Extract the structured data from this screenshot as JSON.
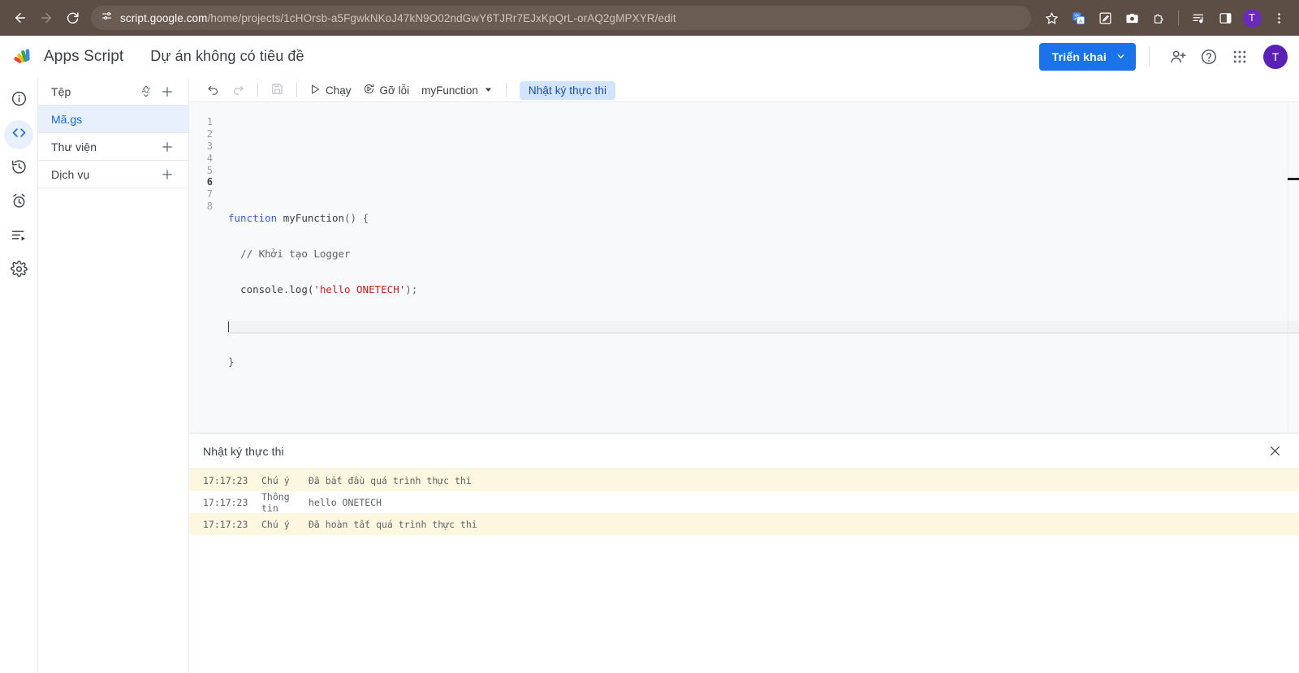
{
  "browser": {
    "back_icon": "arrow-left-icon",
    "forward_icon": "arrow-right-icon",
    "reload_icon": "reload-icon",
    "site_settings_icon": "tune-icon",
    "url_domain": "script.google.com",
    "url_path": "/home/projects/1cHOrsb-a5FgwkNKoJ47kN9O02ndGwY6TJRr7EJxKpQrL-orAQ2gMPXYR/edit",
    "toolbar_icons": [
      "bookmark-star-icon",
      "google-translate-icon",
      "note-edit-icon",
      "screenshot-camera-icon",
      "extensions-puzzle-icon",
      "reading-list-icon",
      "side-panel-icon"
    ],
    "profile_initial": "T",
    "menu_icon": "three-dot-menu-icon",
    "chrome_bg": "#5d4e45"
  },
  "header": {
    "logo_icon": "apps-script-logo",
    "brand": "Apps Script",
    "project_title": "Dự án không có tiêu đề",
    "deploy_label": "Triển khai",
    "deploy_caret_icon": "chevron-down-icon",
    "share_icon": "person-add-icon",
    "help_icon": "help-circle-icon",
    "apps_icon": "apps-grid-icon",
    "avatar_initial": "T",
    "accent": "#1a73e8"
  },
  "rail": {
    "items": [
      {
        "name": "overview",
        "icon": "info-circle-icon",
        "active": false
      },
      {
        "name": "editor",
        "icon": "code-brackets-icon",
        "active": true
      },
      {
        "name": "history",
        "icon": "clock-history-icon",
        "active": false
      },
      {
        "name": "triggers",
        "icon": "alarm-clock-icon",
        "active": false
      },
      {
        "name": "executions",
        "icon": "list-play-icon",
        "active": false
      },
      {
        "name": "settings",
        "icon": "gear-icon",
        "active": false
      }
    ]
  },
  "files": {
    "section_files": "Tệp",
    "sort_icon": "sort-az-icon",
    "add_icon": "plus-icon",
    "items": [
      {
        "name": "Mã.gs",
        "selected": true
      }
    ],
    "section_libraries": "Thư viện",
    "section_services": "Dịch vụ"
  },
  "toolbar": {
    "undo_icon": "undo-icon",
    "redo_icon": "redo-icon",
    "save_icon": "save-disk-icon",
    "run_label": "Chạy",
    "run_icon": "play-icon",
    "debug_label": "Gỡ lỗi",
    "debug_icon": "debug-icon",
    "function_name": "myFunction",
    "function_caret_icon": "chevron-down-icon",
    "execution_log_tab": "Nhật ký thực thi"
  },
  "code": {
    "line_numbers": [
      "1",
      "2",
      "3",
      "4",
      "5",
      "6",
      "7",
      "8"
    ],
    "active_line": 6,
    "lines": [
      {
        "n": 1,
        "text": ""
      },
      {
        "n": 2,
        "text": ""
      },
      {
        "n": 3,
        "text": "function myFunction() {"
      },
      {
        "n": 4,
        "text": "  // Khởi tạo Logger"
      },
      {
        "n": 5,
        "text": "  console.log('hello ONETECH');"
      },
      {
        "n": 6,
        "text": "  "
      },
      {
        "n": 7,
        "text": "}"
      },
      {
        "n": 8,
        "text": ""
      }
    ],
    "tokens": {
      "keyword": "function",
      "fn_name": " myFunction",
      "open": "() {",
      "comment": "// Khởi tạo Logger",
      "console_call": "console.log(",
      "string": "'hello ONETECH'",
      "close_call": ");",
      "close_brace": "}"
    }
  },
  "log": {
    "title": "Nhật ký thực thi",
    "close_icon": "close-icon",
    "rows": [
      {
        "time": "17:17:23",
        "severity": "Chú ý",
        "message": "Đã bắt đầu quá trình thực thi",
        "level": "notice"
      },
      {
        "time": "17:17:23",
        "severity": "Thông tin",
        "message": "hello ONETECH",
        "level": "info"
      },
      {
        "time": "17:17:23",
        "severity": "Chú ý",
        "message": "Đã hoàn tất quá trình thực thi",
        "level": "notice"
      }
    ]
  }
}
